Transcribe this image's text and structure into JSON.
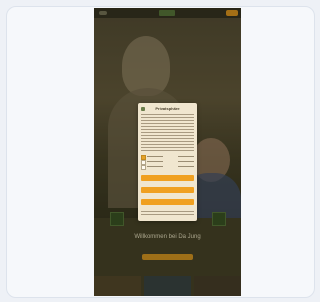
{
  "page": {
    "welcome_heading": "Willkommen bei Da Jung",
    "welcome_button": ""
  },
  "cookie_dialog": {
    "title": "Privatsphäre",
    "body_text": "",
    "options": [
      {
        "label": "",
        "checked": true
      },
      {
        "label": "",
        "checked": false
      },
      {
        "label": "",
        "checked": false
      }
    ],
    "buttons": [
      {
        "label": ""
      },
      {
        "label": ""
      },
      {
        "label": ""
      }
    ],
    "footer_text": ""
  },
  "colors": {
    "accent": "#f0a020",
    "dialog_bg": "#f0e6cf",
    "hero_bg": "#4b4530"
  }
}
